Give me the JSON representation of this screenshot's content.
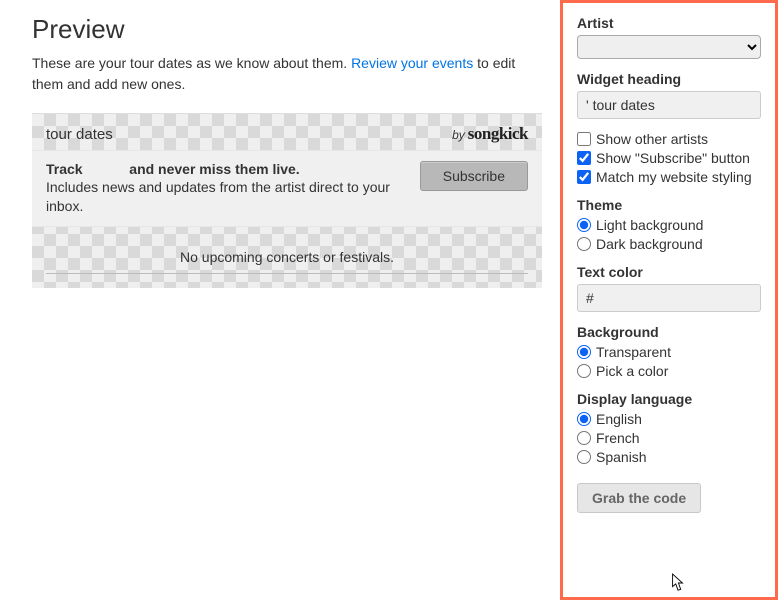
{
  "preview": {
    "title": "Preview",
    "desc_before": "These are your tour dates as we know about them. ",
    "review_link": "Review your events",
    "desc_after": " to edit them and add new ones."
  },
  "widget": {
    "header_title": "tour dates",
    "brand_by": "by",
    "brand_name": "songkick",
    "track_heading_before": "Track",
    "track_heading_after": "and never miss them live.",
    "track_sub": "Includes news and updates from the artist direct to your inbox.",
    "subscribe": "Subscribe",
    "no_events": "No upcoming concerts or festivals."
  },
  "form": {
    "artist_label": "Artist",
    "artist_value": "",
    "heading_label": "Widget heading",
    "heading_value": "' tour dates",
    "cb_other_artists": "Show other artists",
    "cb_subscribe": "Show \"Subscribe\" button",
    "cb_match_style": "Match my website styling",
    "theme_label": "Theme",
    "theme_light": "Light background",
    "theme_dark": "Dark background",
    "textcolor_label": "Text color",
    "textcolor_value": "#",
    "bg_label": "Background",
    "bg_transparent": "Transparent",
    "bg_pick": "Pick a color",
    "lang_label": "Display language",
    "lang_en": "English",
    "lang_fr": "French",
    "lang_es": "Spanish",
    "grab": "Grab the code"
  }
}
